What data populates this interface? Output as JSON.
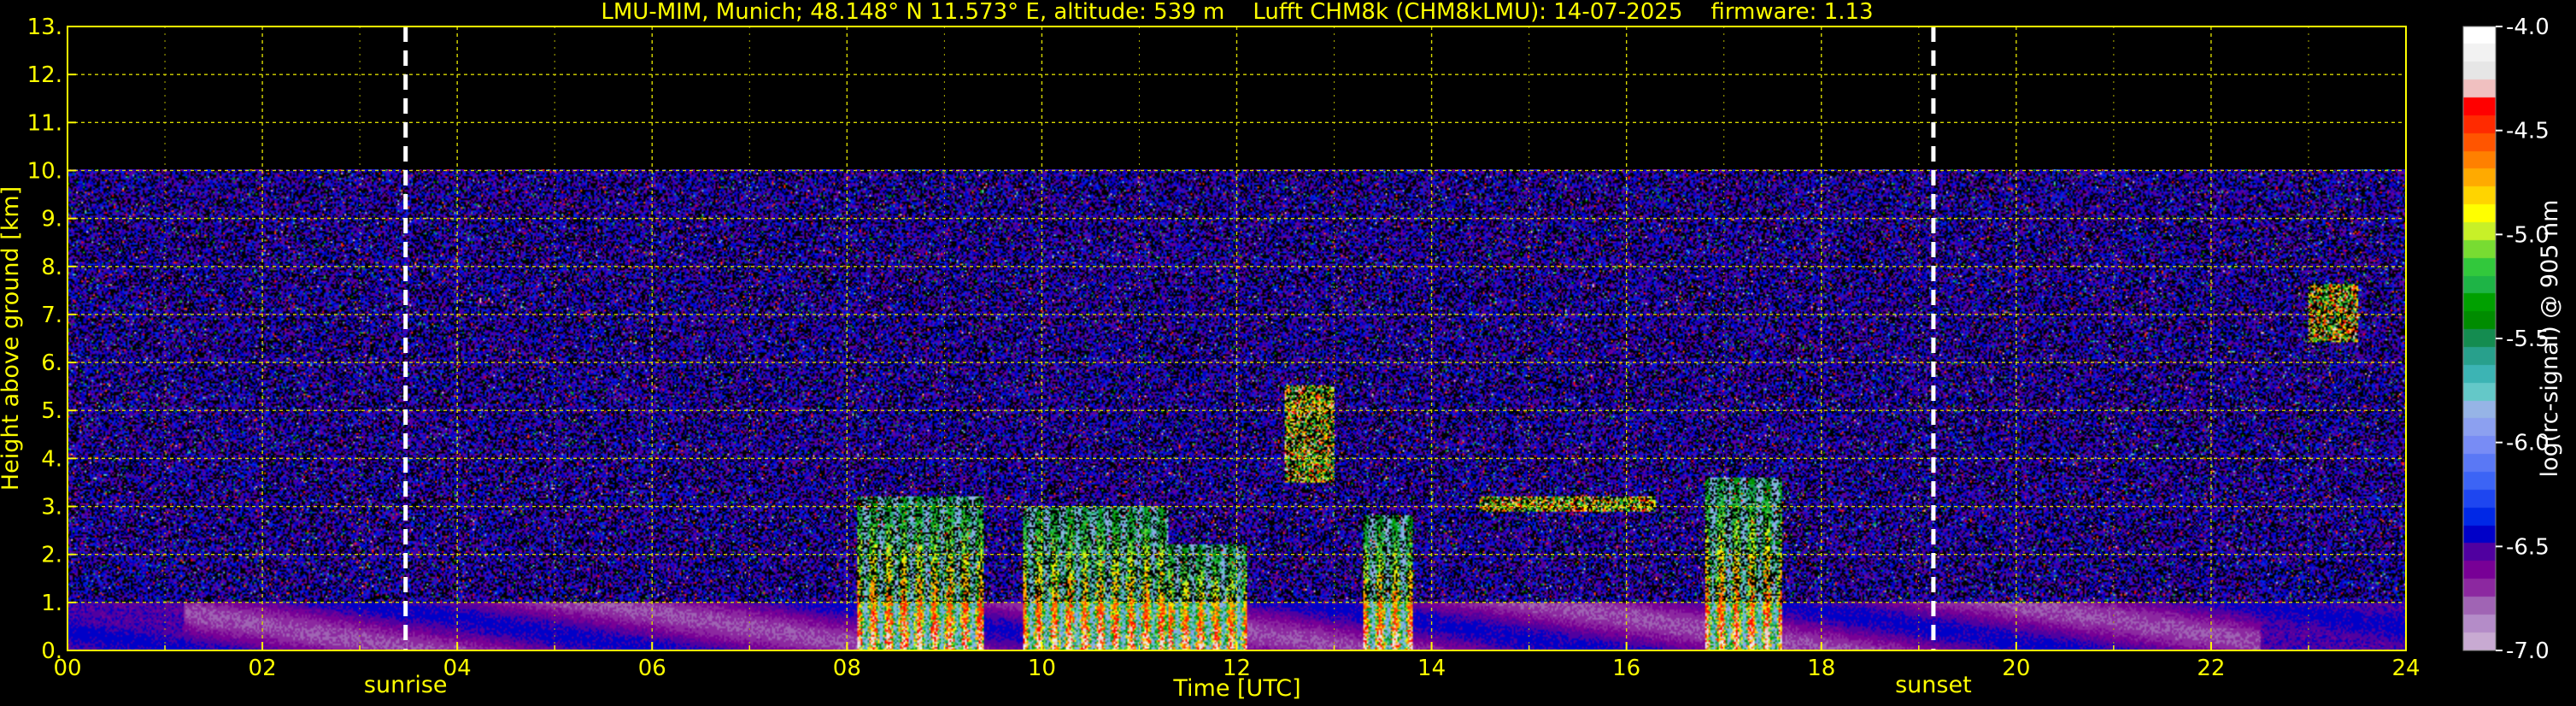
{
  "chart_data": {
    "type": "heatmap",
    "title": "LMU-MIM, Munich; 48.148° N 11.573° E, altitude: 539 m    Lufft CHM8k (CHM8kLMU): 14-07-2025    firmware: 1.13",
    "xlabel": "Time [UTC]",
    "ylabel": "Height above ground [km]",
    "x_range": [
      0,
      24
    ],
    "y_range": [
      0,
      13
    ],
    "x_ticks": [
      0,
      2,
      4,
      6,
      8,
      10,
      12,
      14,
      16,
      18,
      20,
      22,
      24
    ],
    "x_tick_labels": [
      "00",
      "02",
      "04",
      "06",
      "08",
      "10",
      "12",
      "14",
      "16",
      "18",
      "20",
      "22",
      "24"
    ],
    "y_ticks": [
      0,
      1,
      2,
      3,
      4,
      5,
      6,
      7,
      8,
      9,
      10,
      11,
      12,
      13
    ],
    "y_tick_labels": [
      "0.",
      "1.",
      "2.",
      "3.",
      "4.",
      "5.",
      "6.",
      "7.",
      "8.",
      "9.",
      "10.",
      "11.",
      "12.",
      "13."
    ],
    "grid": true,
    "data_ceiling_km": 10,
    "colorbar": {
      "label": "log(rc-signal) @ 905 nm",
      "range": [
        -7.0,
        -4.0
      ],
      "ticks": [
        -4.0,
        -4.5,
        -5.0,
        -5.5,
        -6.0,
        -6.5,
        -7.0
      ],
      "tick_labels": [
        "-4.0",
        "-4.5",
        "-5.0",
        "-5.5",
        "-6.0",
        "-6.5",
        "-7.0"
      ],
      "colors_top_to_bottom": [
        "#ffffff",
        "#f2f2f2",
        "#e6e6e6",
        "#f0c0c0",
        "#ff0000",
        "#ff2a00",
        "#ff5500",
        "#ff8000",
        "#ffaa00",
        "#ffd400",
        "#ffff00",
        "#c8f028",
        "#78dc32",
        "#32c83c",
        "#1eb446",
        "#00a000",
        "#008c00",
        "#148c50",
        "#28a08c",
        "#3cb4b4",
        "#64c8c8",
        "#96b4e6",
        "#8ca0f0",
        "#788cf5",
        "#5a78f5",
        "#3c64f5",
        "#1e46f0",
        "#0028e6",
        "#0000c8",
        "#5000a0",
        "#780096",
        "#8c28a0",
        "#a064b4",
        "#b48cc8",
        "#c8aad2"
      ]
    },
    "annotations": [
      {
        "text": "sunrise",
        "x": 3.47
      },
      {
        "text": "sunset",
        "x": 19.15
      }
    ],
    "features": [
      {
        "kind": "boundary_layer",
        "x": [
          0,
          24
        ],
        "y": [
          0,
          1.0
        ]
      },
      {
        "kind": "convective_cloud",
        "x": [
          8.1,
          9.4
        ],
        "y": [
          0,
          3.2
        ]
      },
      {
        "kind": "convective_cloud",
        "x": [
          9.8,
          11.3
        ],
        "y": [
          0,
          3.0
        ]
      },
      {
        "kind": "convective_cloud",
        "x": [
          11.3,
          12.1
        ],
        "y": [
          0,
          2.2
        ]
      },
      {
        "kind": "convective_cloud",
        "x": [
          13.3,
          13.8
        ],
        "y": [
          0,
          2.8
        ]
      },
      {
        "kind": "convective_cloud",
        "x": [
          16.8,
          17.6
        ],
        "y": [
          0,
          3.6
        ]
      },
      {
        "kind": "cloud_layer",
        "x": [
          14.5,
          16.3
        ],
        "y": [
          2.9,
          3.2
        ]
      },
      {
        "kind": "cloud_layer",
        "x": [
          12.5,
          13.0
        ],
        "y": [
          3.5,
          5.5
        ]
      },
      {
        "kind": "cloud_layer",
        "x": [
          23.0,
          23.5
        ],
        "y": [
          6.4,
          7.6
        ]
      }
    ]
  }
}
